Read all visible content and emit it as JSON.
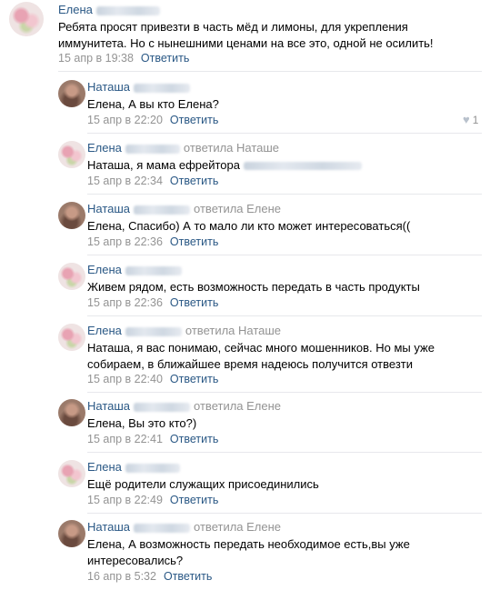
{
  "comments": [
    {
      "author": "Елена",
      "reply_note": "",
      "text": "Ребята просят привезти в часть мёд и лимоны, для укрепления иммунитета. Но с нынешними ценами на все это, одной не осилить!",
      "date": "15 апр в 19:38",
      "reply": "Ответить"
    },
    {
      "author": "Наташа",
      "reply_note": "",
      "text": "Елена, А вы кто Елена?",
      "date": "15 апр в 22:20",
      "reply": "Ответить",
      "likes": "1"
    },
    {
      "author": "Елена",
      "reply_note": "ответила Наташе",
      "text": "Наташа, я мама ефрейтора",
      "date": "15 апр в 22:34",
      "reply": "Ответить"
    },
    {
      "author": "Наташа",
      "reply_note": "ответила Елене",
      "text": "Елена, Спасибо) А то мало ли кто может интересоваться((",
      "date": "15 апр в 22:36",
      "reply": "Ответить"
    },
    {
      "author": "Елена",
      "reply_note": "",
      "text": "Живем рядом, есть возможность передать в часть продукты",
      "date": "15 апр в 22:36",
      "reply": "Ответить"
    },
    {
      "author": "Елена",
      "reply_note": "ответила Наташе",
      "text": "Наташа, я вас понимаю, сейчас много мошенников. Но мы уже собираем, в ближайшее время надеюсь получится отвезти",
      "date": "15 апр в 22:40",
      "reply": "Ответить"
    },
    {
      "author": "Наташа",
      "reply_note": "ответила Елене",
      "text": "Елена, Вы это кто?)",
      "date": "15 апр в 22:41",
      "reply": "Ответить"
    },
    {
      "author": "Елена",
      "reply_note": "",
      "text": "Ещё родители служащих присоединились",
      "date": "15 апр в 22:49",
      "reply": "Ответить"
    },
    {
      "author": "Наташа",
      "reply_note": "ответила Елене",
      "text": "Елена, А возможность передать необходимое есть,вы уже интересовались?",
      "date": "16 апр в 5:32",
      "reply": "Ответить"
    }
  ]
}
